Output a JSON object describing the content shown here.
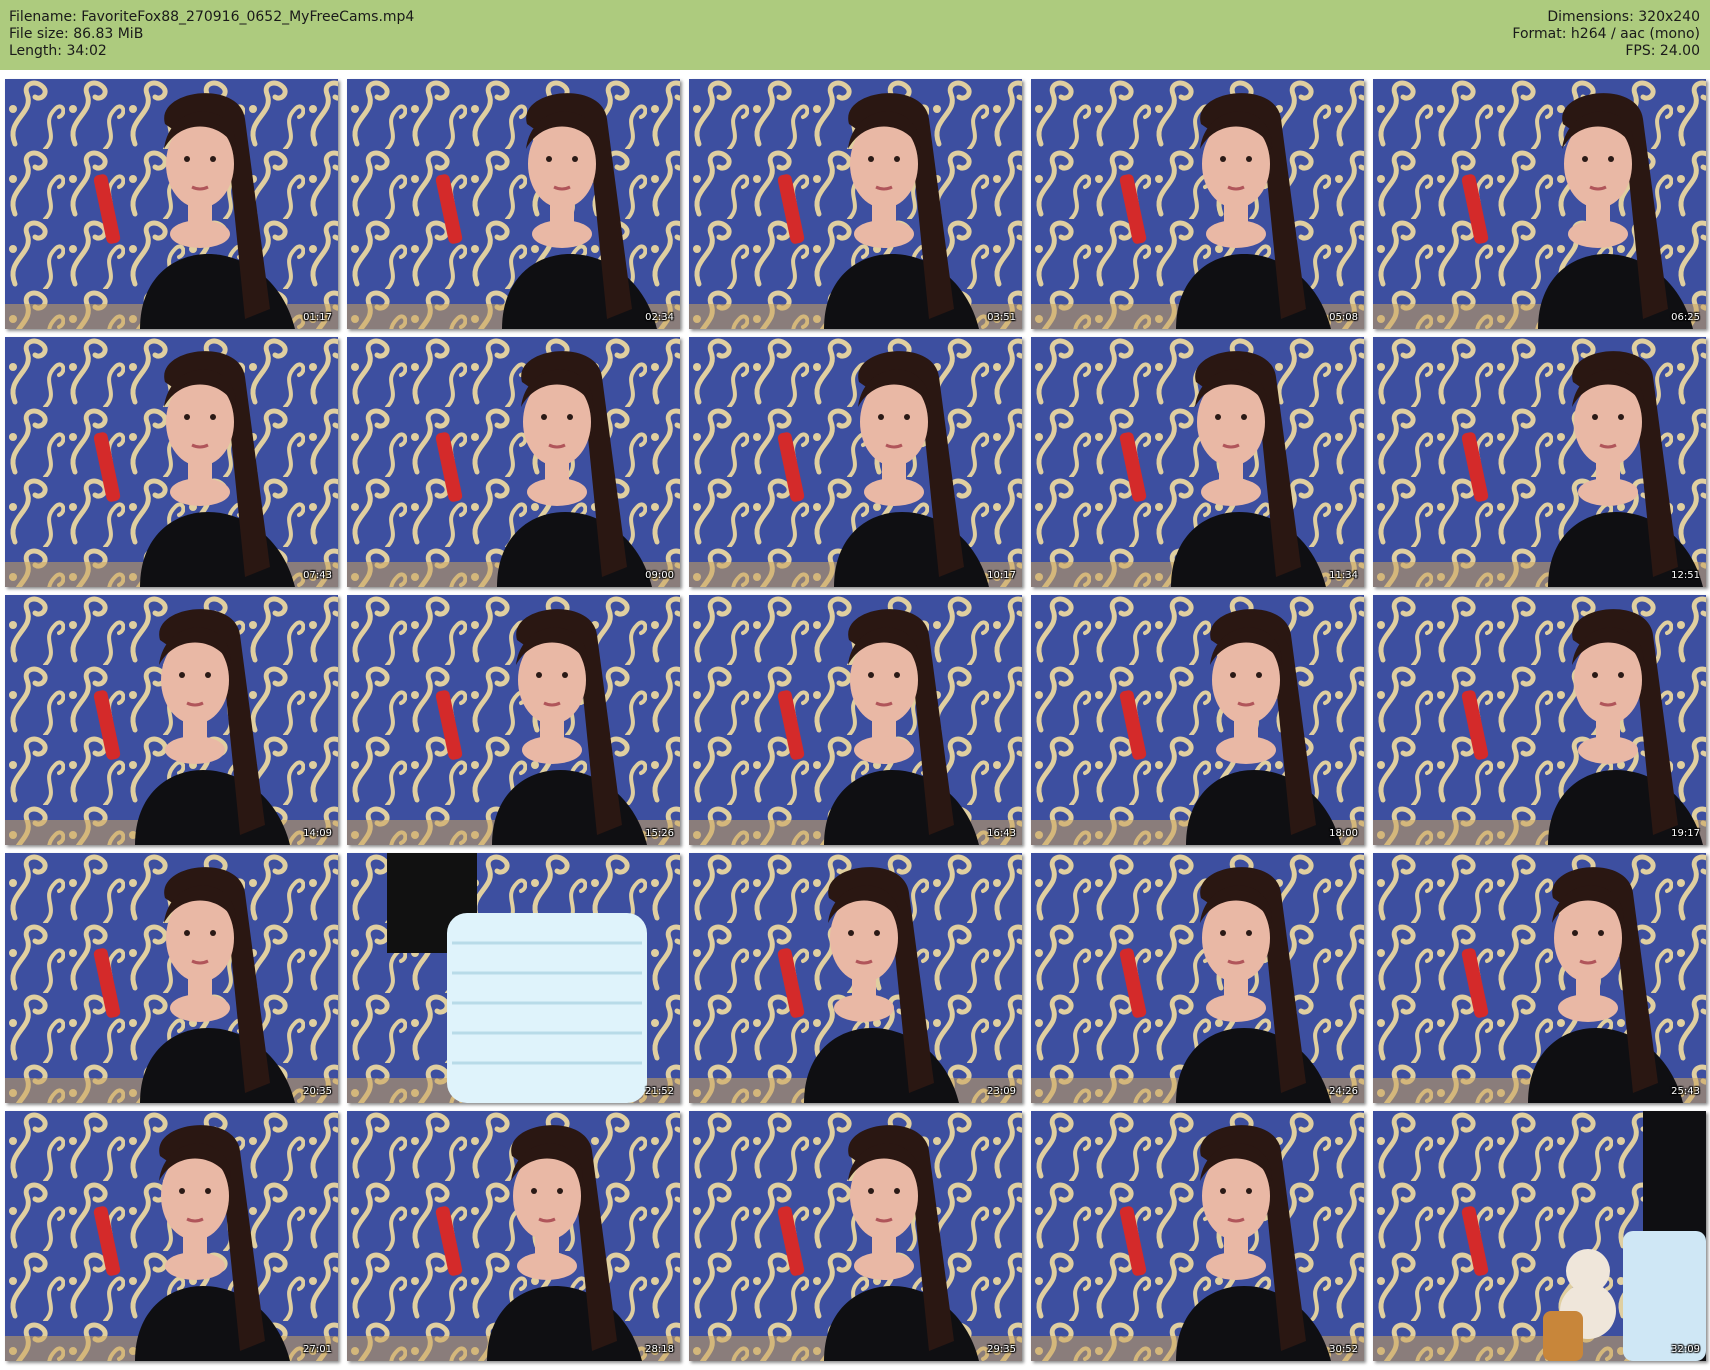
{
  "header": {
    "filename": "Filename: FavoriteFox88_270916_0652_MyFreeCams.mp4",
    "filesize": "File size: 86.83 MiB",
    "length": "Length: 34:02",
    "dimensions": "Dimensions: 320x240",
    "format": "Format: h264 / aac (mono)",
    "fps": "FPS: 24.00"
  },
  "colors": {
    "header_bg": "#adcb7e",
    "wallpaper": "#3d4fa0",
    "pattern": "#e0cfa0",
    "guitar": "#d42a2a"
  },
  "thumbnails": [
    {
      "time": "01:17"
    },
    {
      "time": "02:34"
    },
    {
      "time": "03:51"
    },
    {
      "time": "05:08"
    },
    {
      "time": "06:25"
    },
    {
      "time": "07:43"
    },
    {
      "time": "09:00"
    },
    {
      "time": "10:17"
    },
    {
      "time": "11:34"
    },
    {
      "time": "12:51"
    },
    {
      "time": "14:09"
    },
    {
      "time": "15:26"
    },
    {
      "time": "16:43"
    },
    {
      "time": "18:00"
    },
    {
      "time": "19:17"
    },
    {
      "time": "20:35"
    },
    {
      "time": "21:52"
    },
    {
      "time": "23:09"
    },
    {
      "time": "24:26"
    },
    {
      "time": "25:43"
    },
    {
      "time": "27:01"
    },
    {
      "time": "28:18"
    },
    {
      "time": "29:35"
    },
    {
      "time": "30:52"
    },
    {
      "time": "32:09"
    }
  ]
}
